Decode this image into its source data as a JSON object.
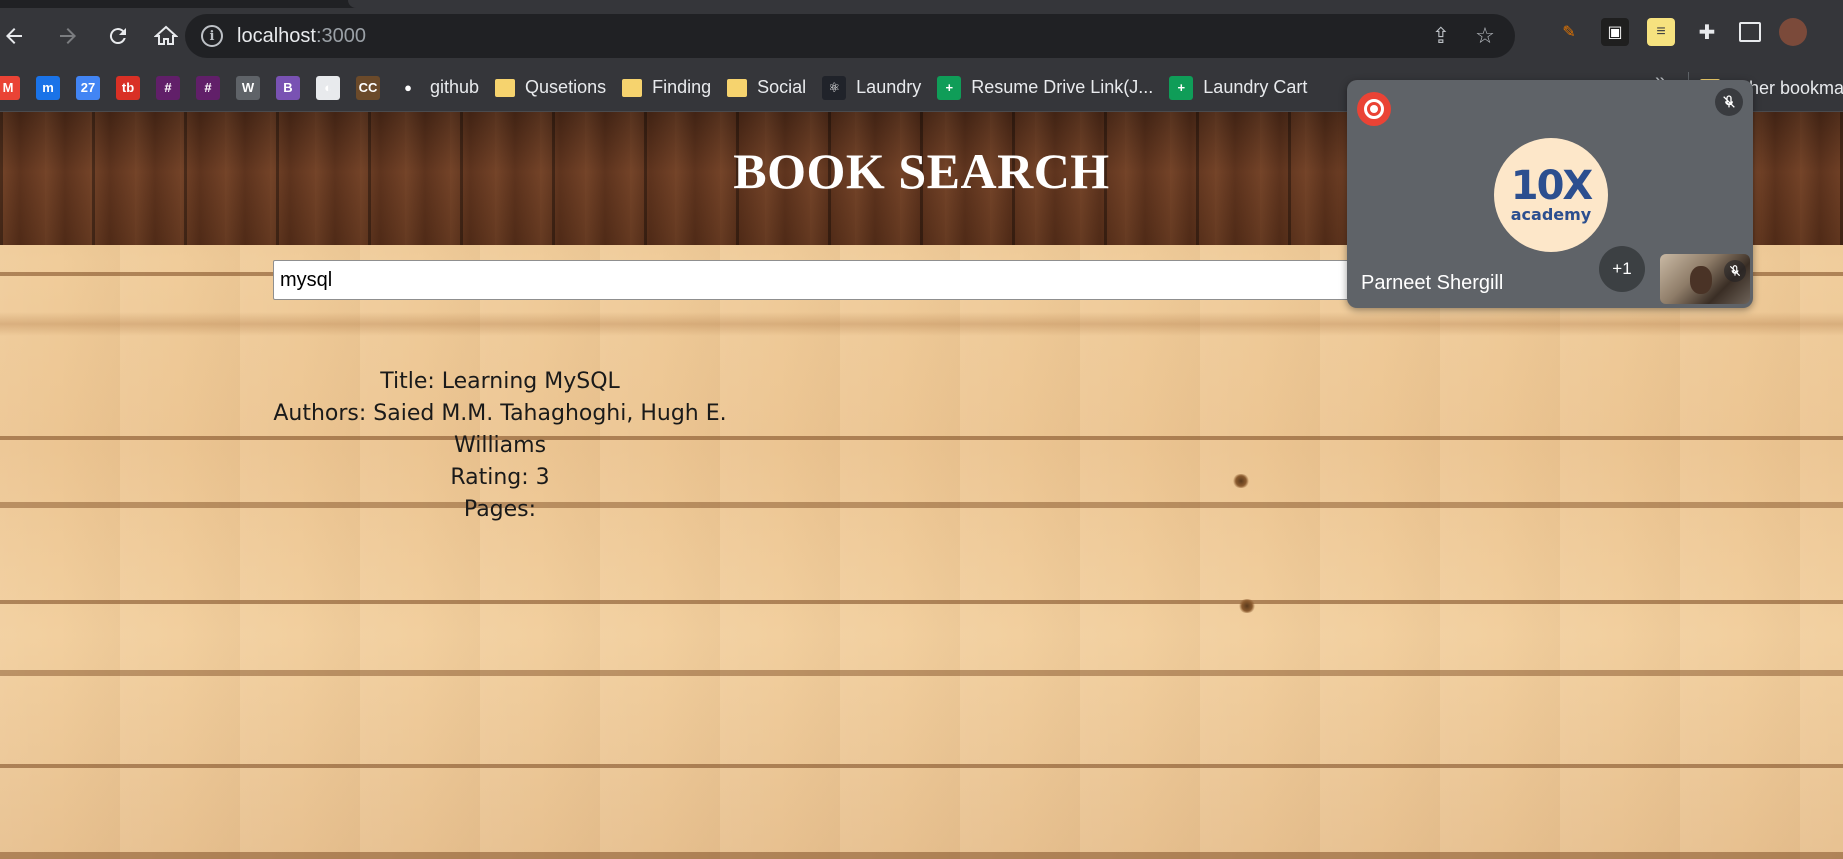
{
  "browser": {
    "url_host": "localhost",
    "url_port": ":3000",
    "bookmarks": [
      {
        "name": "gmail",
        "label": "",
        "icon": "M",
        "color": "#ea4335"
      },
      {
        "name": "m",
        "label": "",
        "icon": "m",
        "color": "#1a73e8"
      },
      {
        "name": "calendar",
        "label": "",
        "icon": "27",
        "color": "#4285f4"
      },
      {
        "name": "tb",
        "label": "",
        "icon": "tb",
        "color": "#d93025"
      },
      {
        "name": "slack-1",
        "label": "",
        "icon": "#",
        "color": "#611f69"
      },
      {
        "name": "slack-2",
        "label": "",
        "icon": "#",
        "color": "#611f69"
      },
      {
        "name": "w",
        "label": "",
        "icon": "W",
        "color": "#5f6368"
      },
      {
        "name": "bootstrap",
        "label": "",
        "icon": "B",
        "color": "#7952b3"
      },
      {
        "name": "app",
        "label": "",
        "icon": "◐",
        "color": "#e8eaed"
      },
      {
        "name": "cc",
        "label": "",
        "icon": "CC",
        "color": "#6b4a2a"
      },
      {
        "name": "github",
        "label": "github",
        "icon": "●",
        "color": "#35363a"
      },
      {
        "name": "folder-quest",
        "label": "Qusetions",
        "icon": "folder"
      },
      {
        "name": "folder-finding",
        "label": "Finding",
        "icon": "folder"
      },
      {
        "name": "folder-social",
        "label": "Social",
        "icon": "folder"
      },
      {
        "name": "laundry",
        "label": "Laundry",
        "icon": "⚛",
        "color": "#20232a"
      },
      {
        "name": "resume",
        "label": "Resume Drive Link(J...",
        "icon": "+",
        "color": "#0f9d58"
      },
      {
        "name": "laundry-cart",
        "label": "Laundry Cart",
        "icon": "+",
        "color": "#0f9d58"
      }
    ],
    "other_bookmarks": "Other bookmarks"
  },
  "page": {
    "title": "BOOK SEARCH",
    "search_value": "mysql",
    "book": {
      "title_line": "Title: Learning MySQL",
      "authors_line": "Authors: Saied M.M. Tahaghoghi, Hugh E. Williams",
      "rating_line": "Rating: 3",
      "pages_line": "Pages:"
    }
  },
  "meet": {
    "participant_name": "Parneet Shergill",
    "extra_count": "+1",
    "logo_big": "10X",
    "logo_small": "academy"
  }
}
